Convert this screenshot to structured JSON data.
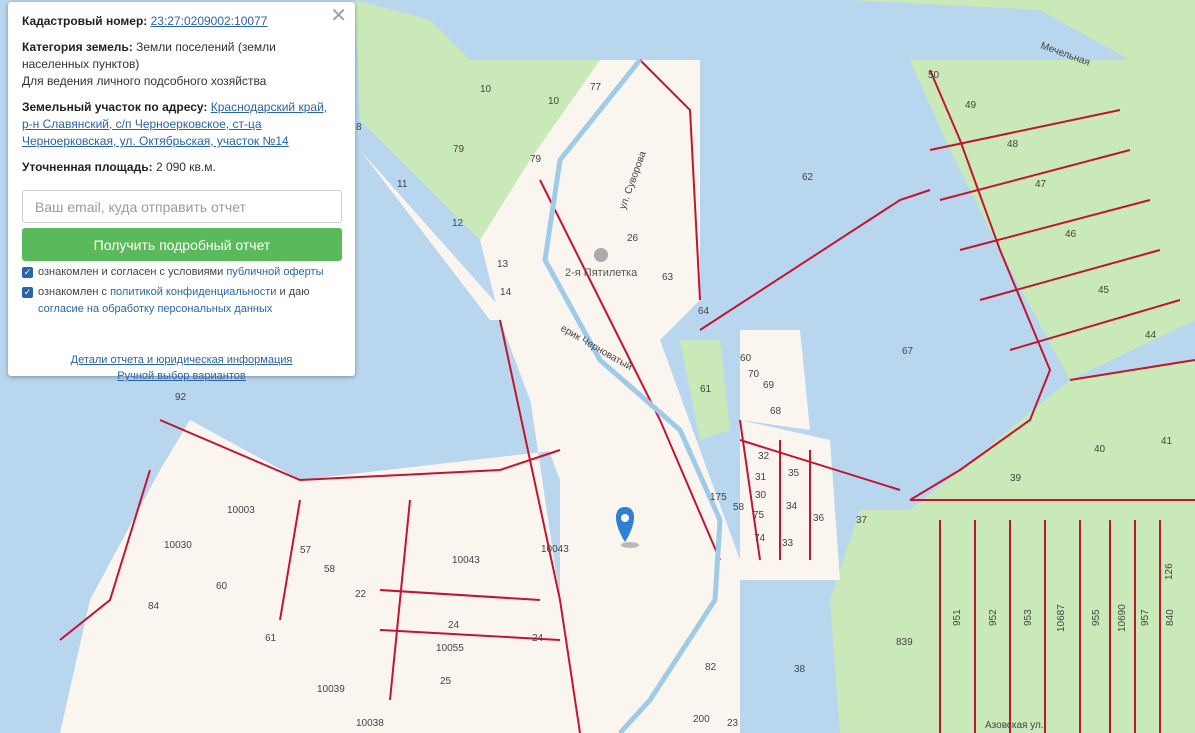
{
  "panel": {
    "cadastral_label": "Кадастровый номер:",
    "cadastral_number": "23:27:0209002:10077",
    "category_label": "Категория земель:",
    "category_value": "Земли поселений (земли населенных пунктов)",
    "purpose": "Для ведения личного подсобного хозяйства",
    "address_label": "Земельный участок по адресу:",
    "address_value": "Краснодарский край, р-н Славянский, с/п Черноерковское, ст-ца Черноерковская, ул. Октябрьская, участок №14",
    "area_label": "Уточненная площадь:",
    "area_value": "2 090 кв.м.",
    "email_placeholder": "Ваш email, куда отправить отчет",
    "button_label": "Получить подробный отчет",
    "consent1_text": "ознакомлен и согласен с условиями ",
    "consent1_link": "публичной оферты",
    "consent2_text": "ознакомлен с ",
    "consent2_link": "политикой конфиденциальности",
    "consent2_mid": " и даю ",
    "consent2_link2": "согласие на обработку персональных данных",
    "details_link": "Детали отчета и юридическая информация",
    "manual_link": "Ручной выбор вариантов"
  },
  "map": {
    "colors": {
      "water": "#b8d6ee",
      "land": "#fbf5f0",
      "green": "#c9eab8",
      "border": "#c2152f"
    },
    "marker_icon": "map-pin-icon",
    "place_label": "2-я Пятилетка",
    "streets": [
      "ул. Суворова",
      "ерик Черноватый",
      "Азовская ул.",
      "Мечельная"
    ],
    "parcel_numbers": [
      "50",
      "49",
      "48",
      "47",
      "46",
      "45",
      "44",
      "62",
      "67",
      "10",
      "10",
      "77",
      "79",
      "79",
      "11",
      "12",
      "13",
      "14",
      "26",
      "63",
      "64",
      "61",
      "60",
      "70",
      "69",
      "68",
      "32",
      "35",
      "31",
      "30",
      "34",
      "75",
      "36",
      "37",
      "74",
      "33",
      "58",
      "175",
      "40",
      "41",
      "39",
      "10003",
      "10030",
      "57",
      "58",
      "22",
      "60",
      "84",
      "61",
      "10043",
      "10043",
      "24",
      "24",
      "10055",
      "25",
      "10039",
      "10038",
      "38",
      "839",
      "951",
      "952",
      "953",
      "10687",
      "955",
      "10690",
      "957",
      "840",
      "126",
      "92",
      "200",
      "82",
      "23",
      "8"
    ]
  }
}
